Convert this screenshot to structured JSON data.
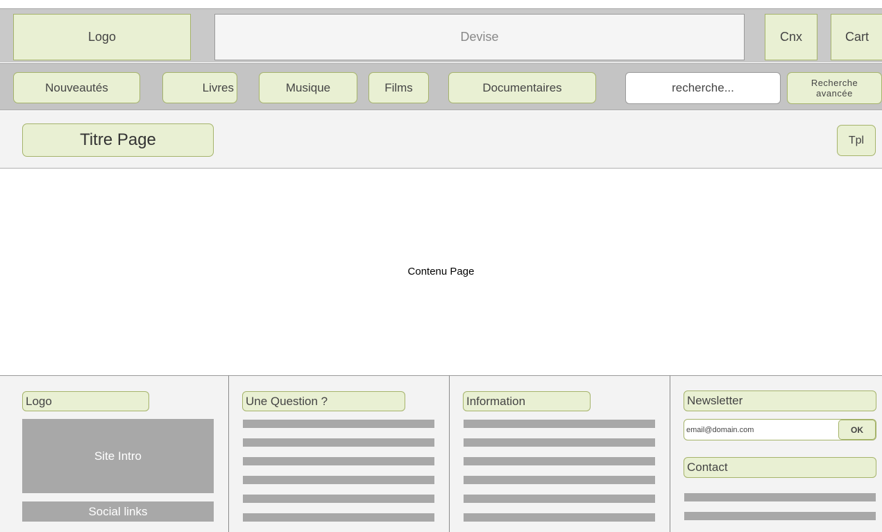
{
  "header": {
    "logo": "Logo",
    "tagline": "Devise",
    "login_button": "Cnx",
    "cart_button": "Cart"
  },
  "nav": {
    "items": [
      "Nouveautés",
      "Livres",
      "Musique",
      "Films",
      "Documentaires"
    ],
    "search_placeholder": "recherche...",
    "advanced_search_line1": "Recherche",
    "advanced_search_line2": "avancée"
  },
  "page": {
    "title": "Titre Page",
    "template_button": "Tpl",
    "content": "Contenu Page"
  },
  "footer": {
    "col1": {
      "logo": "Logo",
      "site_intro": "Site Intro",
      "social_links": "Social links"
    },
    "col2": {
      "heading": "Une Question ?"
    },
    "col3": {
      "heading": "Information"
    },
    "col4": {
      "newsletter_heading": "Newsletter",
      "email_placeholder": "email@domain.com",
      "ok_button": "OK",
      "contact_heading": "Contact"
    }
  },
  "colors": {
    "accent_fill": "#e9f0d3",
    "accent_border": "#a5b36a",
    "band_gray": "#c9c9c9",
    "placeholder_gray": "#a8a8a8"
  }
}
